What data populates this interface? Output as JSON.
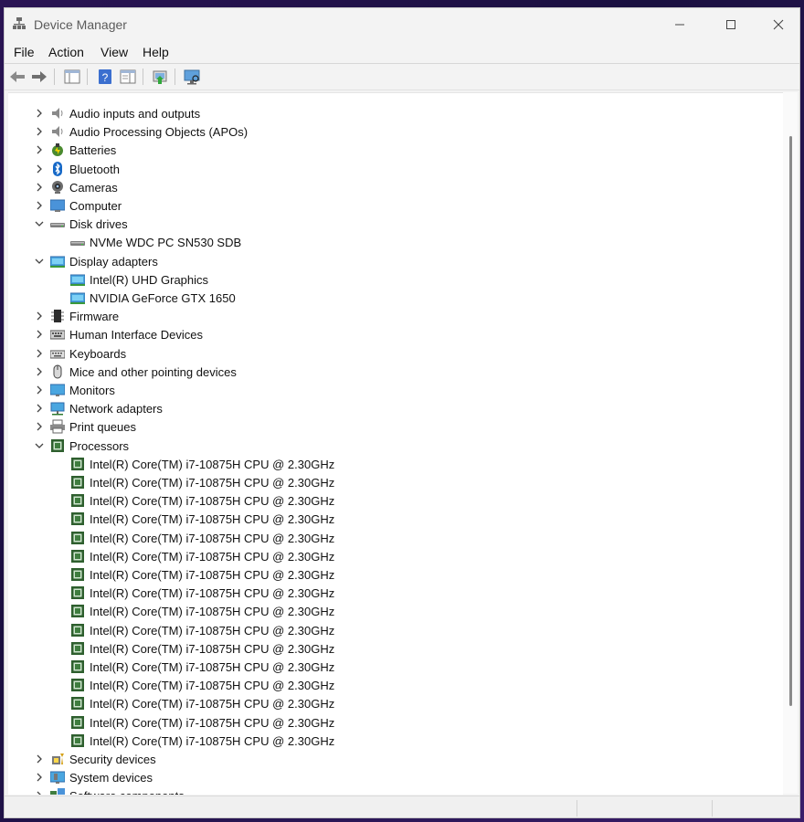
{
  "window": {
    "title": "Device Manager"
  },
  "menu": [
    "File",
    "Action",
    "View",
    "Help"
  ],
  "toolbar": [
    "back-icon",
    "forward-icon",
    "show-hide-tree-icon",
    "help-icon",
    "properties-icon",
    "update-driver-icon",
    "scan-hardware-icon"
  ],
  "tree": [
    {
      "label": "Audio inputs and outputs",
      "level": 0,
      "state": "collapsed",
      "icon": "speaker-icon"
    },
    {
      "label": "Audio Processing Objects (APOs)",
      "level": 0,
      "state": "collapsed",
      "icon": "speaker-icon"
    },
    {
      "label": "Batteries",
      "level": 0,
      "state": "collapsed",
      "icon": "battery-icon"
    },
    {
      "label": "Bluetooth",
      "level": 0,
      "state": "collapsed",
      "icon": "bluetooth-icon"
    },
    {
      "label": "Cameras",
      "level": 0,
      "state": "collapsed",
      "icon": "camera-icon"
    },
    {
      "label": "Computer",
      "level": 0,
      "state": "collapsed",
      "icon": "computer-icon"
    },
    {
      "label": "Disk drives",
      "level": 0,
      "state": "expanded",
      "icon": "disk-drive-icon"
    },
    {
      "label": "NVMe WDC PC SN530 SDB",
      "level": 1,
      "state": "none",
      "icon": "disk-drive-icon"
    },
    {
      "label": "Display adapters",
      "level": 0,
      "state": "expanded",
      "icon": "display-adapter-icon"
    },
    {
      "label": "Intel(R) UHD Graphics",
      "level": 1,
      "state": "none",
      "icon": "display-adapter-icon"
    },
    {
      "label": "NVIDIA GeForce GTX 1650",
      "level": 1,
      "state": "none",
      "icon": "display-adapter-icon"
    },
    {
      "label": "Firmware",
      "level": 0,
      "state": "collapsed",
      "icon": "firmware-icon"
    },
    {
      "label": "Human Interface Devices",
      "level": 0,
      "state": "collapsed",
      "icon": "hid-icon"
    },
    {
      "label": "Keyboards",
      "level": 0,
      "state": "collapsed",
      "icon": "keyboard-icon"
    },
    {
      "label": "Mice and other pointing devices",
      "level": 0,
      "state": "collapsed",
      "icon": "mouse-icon"
    },
    {
      "label": "Monitors",
      "level": 0,
      "state": "collapsed",
      "icon": "monitor-icon"
    },
    {
      "label": "Network adapters",
      "level": 0,
      "state": "collapsed",
      "icon": "network-adapter-icon"
    },
    {
      "label": "Print queues",
      "level": 0,
      "state": "collapsed",
      "icon": "printer-icon"
    },
    {
      "label": "Processors",
      "level": 0,
      "state": "expanded",
      "icon": "processor-icon"
    },
    {
      "label": "Intel(R) Core(TM) i7-10875H CPU @ 2.30GHz",
      "level": 1,
      "state": "none",
      "icon": "processor-icon"
    },
    {
      "label": "Intel(R) Core(TM) i7-10875H CPU @ 2.30GHz",
      "level": 1,
      "state": "none",
      "icon": "processor-icon"
    },
    {
      "label": "Intel(R) Core(TM) i7-10875H CPU @ 2.30GHz",
      "level": 1,
      "state": "none",
      "icon": "processor-icon"
    },
    {
      "label": "Intel(R) Core(TM) i7-10875H CPU @ 2.30GHz",
      "level": 1,
      "state": "none",
      "icon": "processor-icon"
    },
    {
      "label": "Intel(R) Core(TM) i7-10875H CPU @ 2.30GHz",
      "level": 1,
      "state": "none",
      "icon": "processor-icon"
    },
    {
      "label": "Intel(R) Core(TM) i7-10875H CPU @ 2.30GHz",
      "level": 1,
      "state": "none",
      "icon": "processor-icon"
    },
    {
      "label": "Intel(R) Core(TM) i7-10875H CPU @ 2.30GHz",
      "level": 1,
      "state": "none",
      "icon": "processor-icon"
    },
    {
      "label": "Intel(R) Core(TM) i7-10875H CPU @ 2.30GHz",
      "level": 1,
      "state": "none",
      "icon": "processor-icon"
    },
    {
      "label": "Intel(R) Core(TM) i7-10875H CPU @ 2.30GHz",
      "level": 1,
      "state": "none",
      "icon": "processor-icon"
    },
    {
      "label": "Intel(R) Core(TM) i7-10875H CPU @ 2.30GHz",
      "level": 1,
      "state": "none",
      "icon": "processor-icon"
    },
    {
      "label": "Intel(R) Core(TM) i7-10875H CPU @ 2.30GHz",
      "level": 1,
      "state": "none",
      "icon": "processor-icon"
    },
    {
      "label": "Intel(R) Core(TM) i7-10875H CPU @ 2.30GHz",
      "level": 1,
      "state": "none",
      "icon": "processor-icon"
    },
    {
      "label": "Intel(R) Core(TM) i7-10875H CPU @ 2.30GHz",
      "level": 1,
      "state": "none",
      "icon": "processor-icon"
    },
    {
      "label": "Intel(R) Core(TM) i7-10875H CPU @ 2.30GHz",
      "level": 1,
      "state": "none",
      "icon": "processor-icon"
    },
    {
      "label": "Intel(R) Core(TM) i7-10875H CPU @ 2.30GHz",
      "level": 1,
      "state": "none",
      "icon": "processor-icon"
    },
    {
      "label": "Intel(R) Core(TM) i7-10875H CPU @ 2.30GHz",
      "level": 1,
      "state": "none",
      "icon": "processor-icon"
    },
    {
      "label": "Security devices",
      "level": 0,
      "state": "collapsed",
      "icon": "security-device-icon"
    },
    {
      "label": "System devices",
      "level": 0,
      "state": "collapsed",
      "icon": "system-device-icon"
    },
    {
      "label": "Software components",
      "level": 0,
      "state": "collapsed",
      "icon": "software-component-icon"
    }
  ]
}
